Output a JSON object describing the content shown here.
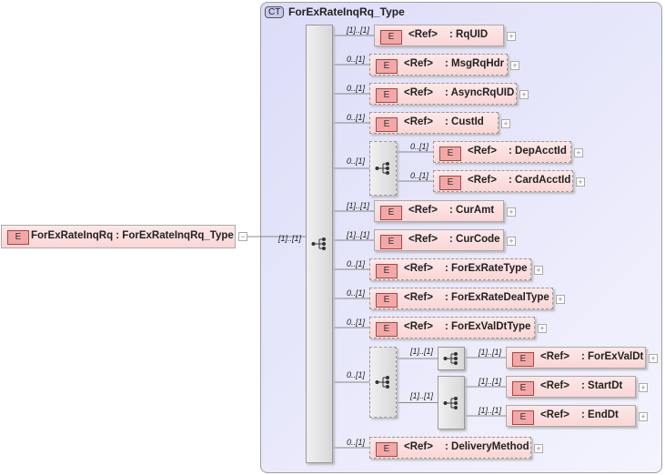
{
  "root": {
    "badge": "E",
    "label": "ForExRateInqRq : ForExRateInqRq_Type",
    "multiplicity": "[1]..[1]"
  },
  "complex_type": {
    "badge": "CT",
    "title": "ForExRateInqRq_Type"
  },
  "elements": [
    {
      "mult": "[1]..[1]",
      "ref": "<Ref>",
      "name": ": RqUID"
    },
    {
      "mult": "0..[1]",
      "ref": "<Ref>",
      "name": ": MsgRqHdr"
    },
    {
      "mult": "0..[1]",
      "ref": "<Ref>",
      "name": ": AsyncRqUID"
    },
    {
      "mult": "0..[1]",
      "ref": "<Ref>",
      "name": ": CustId"
    },
    {
      "mult": "0..[1]",
      "ref": "<Ref>",
      "name": ": DepAcctId"
    },
    {
      "mult": "0..[1]",
      "ref": "<Ref>",
      "name": ": CardAcctId"
    },
    {
      "mult": "[1]..[1]",
      "ref": "<Ref>",
      "name": ": CurAmt"
    },
    {
      "mult": "[1]..[1]",
      "ref": "<Ref>",
      "name": ": CurCode"
    },
    {
      "mult": "0..[1]",
      "ref": "<Ref>",
      "name": ": ForExRateType"
    },
    {
      "mult": "0..[1]",
      "ref": "<Ref>",
      "name": ": ForExRateDealType"
    },
    {
      "mult": "0..[1]",
      "ref": "<Ref>",
      "name": ": ForExValDtType"
    },
    {
      "mult": "[1]..[1]",
      "ref": "<Ref>",
      "name": ": ForExValDt"
    },
    {
      "mult": "[1]..[1]",
      "ref": "<Ref>",
      "name": ": StartDt"
    },
    {
      "mult": "[1]..[1]",
      "ref": "<Ref>",
      "name": ": EndDt"
    },
    {
      "mult": "0..[1]",
      "ref": "<Ref>",
      "name": ": DeliveryMethod"
    }
  ],
  "compositors": [
    {
      "mult": "0..[1]"
    },
    {
      "mult": "0..[1]"
    },
    {
      "mult": "[1]..[1]"
    },
    {
      "mult": "[1]..[1]"
    }
  ],
  "element_badge": "E",
  "expand_symbol": "+"
}
